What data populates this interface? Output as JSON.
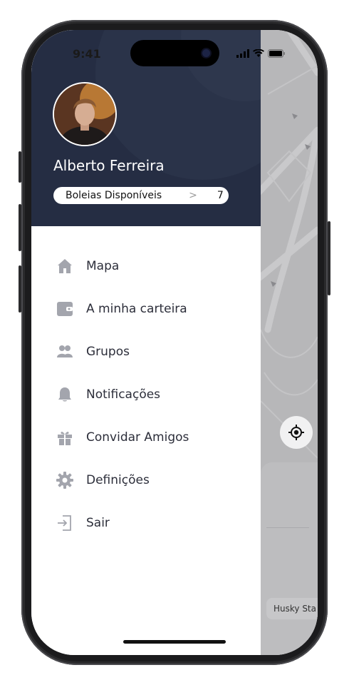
{
  "status_bar": {
    "time": "9:41"
  },
  "profile": {
    "name": "Alberto Ferreira"
  },
  "rides": {
    "label": "Boleias Disponíveis",
    "count": "7"
  },
  "menu": [
    {
      "label": "Mapa",
      "icon": "home-icon"
    },
    {
      "label": "A minha carteira",
      "icon": "wallet-icon"
    },
    {
      "label": "Grupos",
      "icon": "groups-icon"
    },
    {
      "label": "Notificações",
      "icon": "bell-icon"
    },
    {
      "label": "Convidar Amigos",
      "icon": "gift-icon"
    },
    {
      "label": "Definições",
      "icon": "gear-icon"
    },
    {
      "label": "Sair",
      "icon": "logout-icon"
    }
  ],
  "map": {
    "chip_text": "Husky Sta"
  },
  "colors": {
    "header_bg": "#252d43",
    "icon_gray": "#a3a5ad",
    "text": "#2c2e3a",
    "map_bg": "#b7b7b9"
  }
}
